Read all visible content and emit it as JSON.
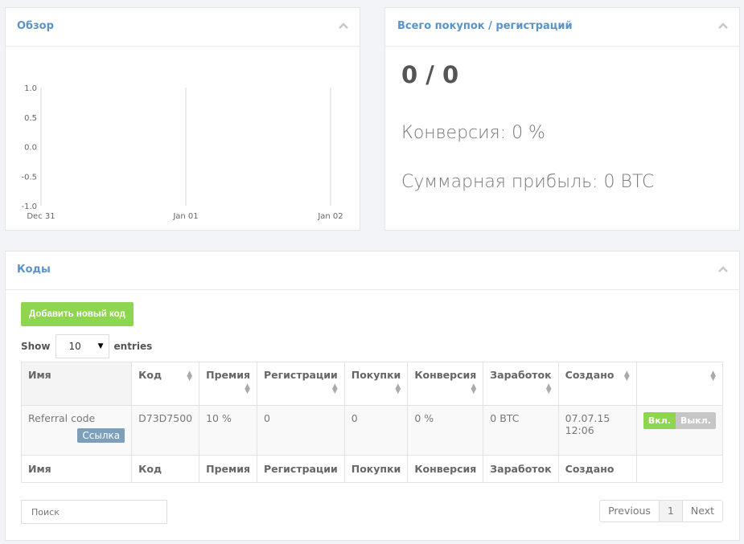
{
  "overview": {
    "title": "Обзор",
    "icon": "chevron-up-icon"
  },
  "chart_data": {
    "type": "line",
    "title": "",
    "xlabel": "",
    "ylabel": "",
    "x_ticks": [
      "Dec 31",
      "Jan 01",
      "Jan 02"
    ],
    "y_ticks": [
      "1.0",
      "0.5",
      "0.0",
      "-0.5",
      "-1.0"
    ],
    "ylim": [
      -1,
      1
    ],
    "series": [],
    "grid": "vertical"
  },
  "totals": {
    "title": "Всего покупок / регистраций",
    "value": "0 / 0",
    "conversion": "Конверсия: 0 %",
    "profit": "Суммарная прибыль: 0 BTC"
  },
  "codes": {
    "title": "Коды",
    "add_button": "Добавить новый код",
    "show_label": "Show",
    "entries_value": "10",
    "entries_label": "entries",
    "columns": [
      "Имя",
      "Код",
      "Премия",
      "Регистрации",
      "Покупки",
      "Конверсия",
      "Заработок",
      "Создано",
      ""
    ],
    "rows": [
      {
        "name": "Referral code",
        "link": "Ссылка",
        "code": "D73D7500",
        "bonus": "10 %",
        "registrations": "0",
        "purchases": "0",
        "conversion": "0 %",
        "earnings": "0 BTC",
        "created_date": "07.07.15",
        "created_time": "12:06",
        "toggle_on": "Вкл.",
        "toggle_off": "Выкл."
      }
    ],
    "search_placeholder": "Поиск",
    "pagination": {
      "previous": "Previous",
      "current": "1",
      "next": "Next"
    }
  },
  "colors": {
    "accent": "#5a93c8",
    "green": "#8fd650",
    "link": "#7e9fb9"
  }
}
